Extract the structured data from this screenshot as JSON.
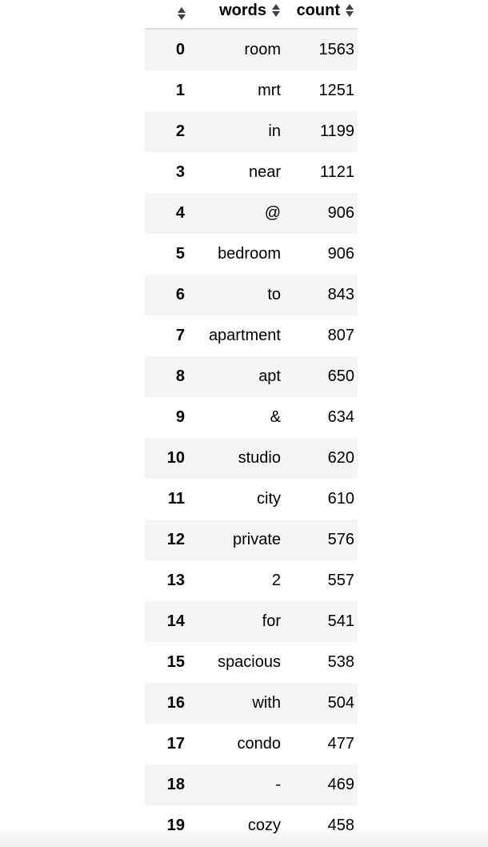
{
  "table": {
    "columns": [
      {
        "key": "index",
        "label": "",
        "sort_icon": "sort-icon",
        "align": "right"
      },
      {
        "key": "words",
        "label": "words",
        "sort_icon": "sort-icon",
        "align": "right"
      },
      {
        "key": "count",
        "label": "count",
        "sort_icon": "sort-icon",
        "align": "right"
      }
    ],
    "header": {
      "index_label": "",
      "words_label": "words",
      "count_label": "count"
    },
    "rows": [
      {
        "index": "0",
        "words": "room",
        "count": "1563"
      },
      {
        "index": "1",
        "words": "mrt",
        "count": "1251"
      },
      {
        "index": "2",
        "words": "in",
        "count": "1199"
      },
      {
        "index": "3",
        "words": "near",
        "count": "1121"
      },
      {
        "index": "4",
        "words": "@",
        "count": "906"
      },
      {
        "index": "5",
        "words": "bedroom",
        "count": "906"
      },
      {
        "index": "6",
        "words": "to",
        "count": "843"
      },
      {
        "index": "7",
        "words": "apartment",
        "count": "807"
      },
      {
        "index": "8",
        "words": "apt",
        "count": "650"
      },
      {
        "index": "9",
        "words": "&",
        "count": "634"
      },
      {
        "index": "10",
        "words": "studio",
        "count": "620"
      },
      {
        "index": "11",
        "words": "city",
        "count": "610"
      },
      {
        "index": "12",
        "words": "private",
        "count": "576"
      },
      {
        "index": "13",
        "words": "2",
        "count": "557"
      },
      {
        "index": "14",
        "words": "for",
        "count": "541"
      },
      {
        "index": "15",
        "words": "spacious",
        "count": "538"
      },
      {
        "index": "16",
        "words": "with",
        "count": "504"
      },
      {
        "index": "17",
        "words": "condo",
        "count": "477"
      },
      {
        "index": "18",
        "words": "-",
        "count": "469"
      },
      {
        "index": "19",
        "words": "cozy",
        "count": "458"
      }
    ]
  },
  "colors": {
    "page_background": "#ffffff",
    "row_stripe": "#f5f5f5",
    "row_plain": "#ffffff",
    "header_rule": "#dcdcdc",
    "text": "#000000",
    "sort_icon": "#3a4248"
  }
}
